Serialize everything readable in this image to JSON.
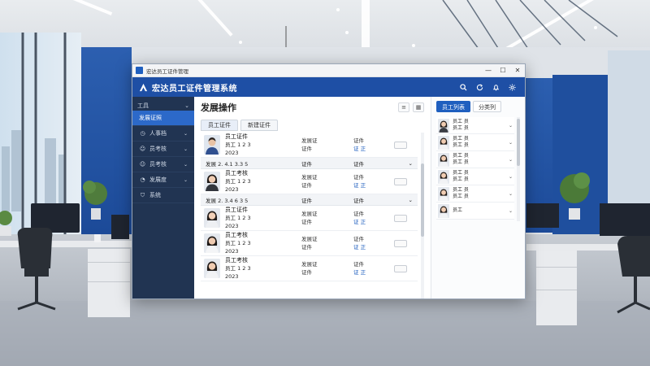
{
  "window": {
    "title": "宏达员工证件管理",
    "controls": [
      "—",
      "☐",
      "✕"
    ]
  },
  "header": {
    "app_title": "宏达员工证件管理系统",
    "icons": [
      "search-icon",
      "refresh-icon",
      "bell-icon",
      "settings-icon"
    ]
  },
  "sidebar": {
    "group_label": "工具",
    "items": [
      {
        "label": "发展证照",
        "icon": "doc-icon",
        "active": true
      },
      {
        "label": "人事档",
        "icon": "clock-icon",
        "active": false
      },
      {
        "label": "员考核",
        "icon": "user-icon",
        "active": false
      },
      {
        "label": "员考核",
        "icon": "user-icon",
        "active": false
      },
      {
        "label": "发展度",
        "icon": "chart-icon",
        "active": false
      },
      {
        "label": "系统",
        "icon": "shield-icon",
        "active": false
      }
    ]
  },
  "main": {
    "title": "发展操作",
    "tabs": [
      "员工证件",
      "新建证件"
    ],
    "rows": [
      {
        "kind": "card",
        "name": "员工证件",
        "id": "员工 1 2 3",
        "date": "2023",
        "type": "发展证",
        "type2": "证件",
        "status": "证件",
        "status2": "证 正"
      },
      {
        "kind": "sub",
        "a": "发展 2. 4.1 3.3 5",
        "b": "证件",
        "c": "证件"
      },
      {
        "kind": "card",
        "name": "员工考核",
        "id": "员工 1 2 3",
        "date": "2023",
        "type": "发展证",
        "type2": "证件",
        "status": "证件",
        "status2": "证 正"
      },
      {
        "kind": "sub",
        "a": "发展 2. 3.4 6 3 5",
        "b": "证件",
        "c": "证件"
      },
      {
        "kind": "card",
        "name": "员工证件",
        "id": "员工 1 2 3",
        "date": "2023",
        "type": "发展证",
        "type2": "证件",
        "status": "证件",
        "status2": "证 正"
      },
      {
        "kind": "card",
        "name": "员工考核",
        "id": "员工 1 2 3",
        "date": "2023",
        "type": "发展证",
        "type2": "证件",
        "status": "证件",
        "status2": "证 正"
      },
      {
        "kind": "card",
        "name": "员工考核",
        "id": "员工 1 2 3",
        "date": "2023",
        "type": "发展证",
        "type2": "证件",
        "status": "证件",
        "status2": "证 正"
      }
    ]
  },
  "right": {
    "tabs": [
      "员工列表",
      "分类列"
    ],
    "items": [
      {
        "l1": "员工 员",
        "l2": "员工 员"
      },
      {
        "l1": "员工 员",
        "l2": "员工 员"
      },
      {
        "l1": "员工 员",
        "l2": "员工 员"
      },
      {
        "l1": "员工 员",
        "l2": "员工 员"
      },
      {
        "l1": "员工 员",
        "l2": "员工 员"
      },
      {
        "l1": "员工",
        "l2": ""
      }
    ]
  }
}
